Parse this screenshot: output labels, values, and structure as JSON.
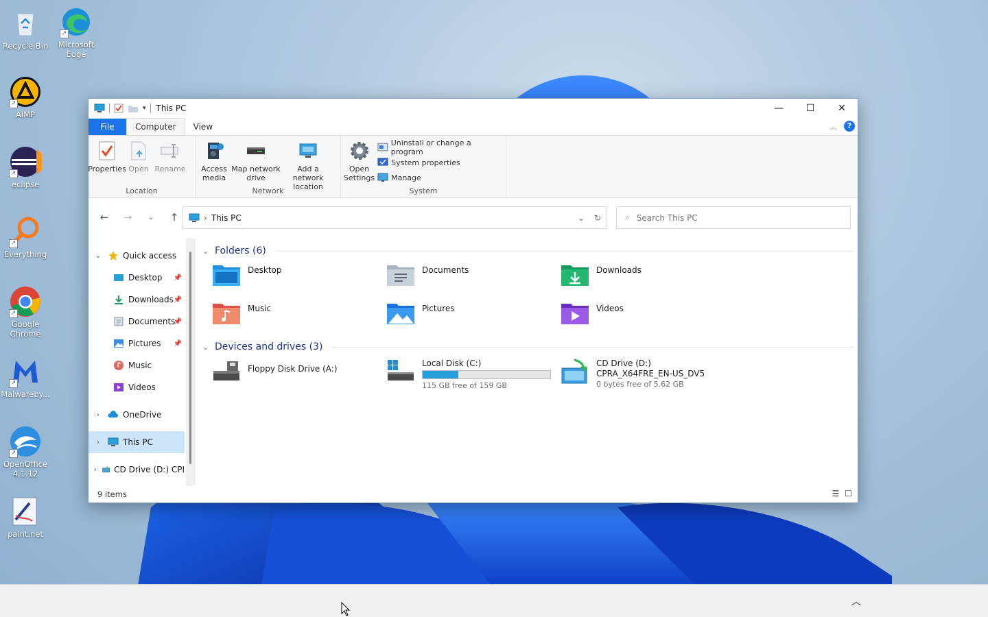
{
  "desktop": {
    "icons": [
      {
        "label": "Recycle Bin",
        "icon": "recycle-bin-icon"
      },
      {
        "label": "Microsoft Edge",
        "icon": "edge-icon"
      },
      {
        "label": "AIMP",
        "icon": "aimp-icon"
      },
      {
        "label": "eclipse",
        "icon": "eclipse-icon"
      },
      {
        "label": "Everything",
        "icon": "everything-icon"
      },
      {
        "label": "Google Chrome",
        "icon": "chrome-icon"
      },
      {
        "label": "Malwareby...",
        "icon": "malwarebytes-icon"
      },
      {
        "label": "OpenOffice 4.1.12",
        "icon": "openoffice-icon"
      },
      {
        "label": "paint.net",
        "icon": "paintnet-icon"
      }
    ]
  },
  "window": {
    "title": "This PC",
    "tabs": {
      "file": "File",
      "computer": "Computer",
      "view": "View"
    },
    "help": "?"
  },
  "ribbon": {
    "location": {
      "label": "Location",
      "properties": "Properties",
      "open": "Open",
      "rename": "Rename"
    },
    "network": {
      "label": "Network",
      "access_media": "Access media",
      "map_drive": "Map network drive",
      "add_location": "Add a network location"
    },
    "system": {
      "label": "System",
      "open_settings": "Open Settings",
      "uninstall": "Uninstall or change a program",
      "system_properties": "System properties",
      "manage": "Manage"
    }
  },
  "address": {
    "path": "This PC",
    "search_placeholder": "Search This PC"
  },
  "nav": {
    "quick_access": "Quick access",
    "items": [
      "Desktop",
      "Downloads",
      "Documents",
      "Pictures",
      "Music",
      "Videos"
    ],
    "onedrive": "OneDrive",
    "this_pc": "This PC",
    "cd_drive": "CD Drive (D:) CPI"
  },
  "content": {
    "folders_header": "Folders (6)",
    "folders": [
      "Desktop",
      "Documents",
      "Downloads",
      "Music",
      "Pictures",
      "Videos"
    ],
    "drives_header": "Devices and drives (3)",
    "drives": {
      "floppy": "Floppy Disk Drive (A:)",
      "local": {
        "name": "Local Disk (C:)",
        "free": "115 GB free of 159 GB",
        "used_fraction": 0.277
      },
      "cd": {
        "name": "CD Drive (D:)",
        "label": "CPRA_X64FRE_EN-US_DV5",
        "free": "0 bytes free of 5.62 GB"
      }
    }
  },
  "status": {
    "items": "9 items"
  },
  "colors": {
    "accent": "#1a73e8",
    "disk_fill": "#26a0da",
    "selection": "#cce4f7"
  }
}
